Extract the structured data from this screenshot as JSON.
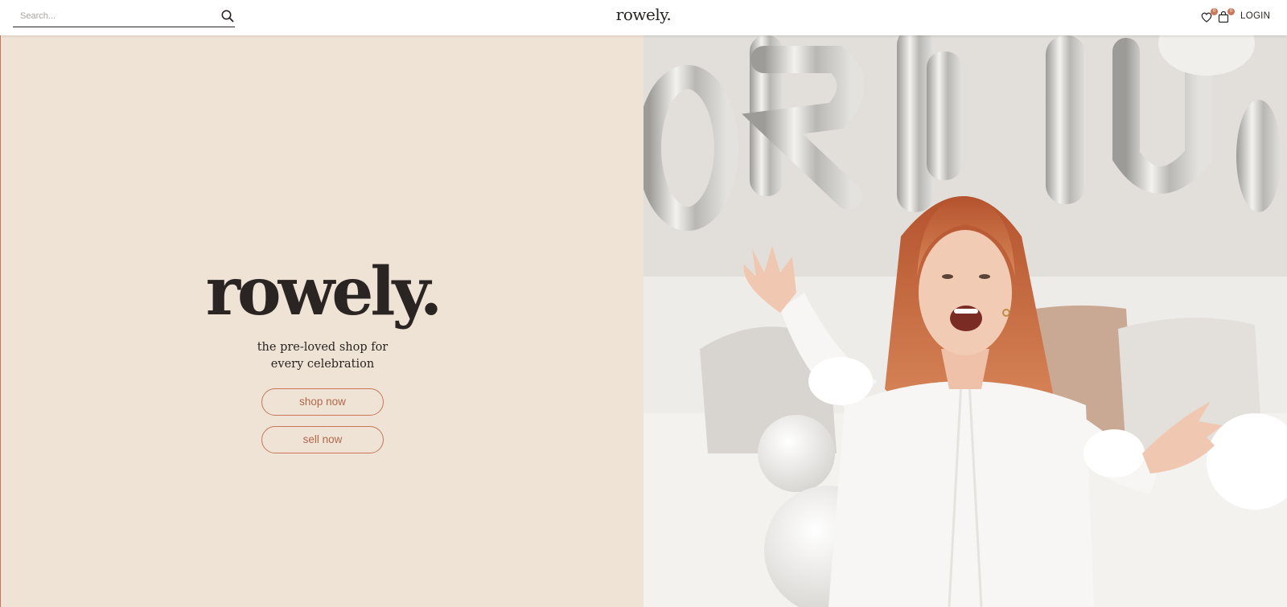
{
  "header": {
    "search": {
      "placeholder": "Search..."
    },
    "brand": "rowely.",
    "wishlist_count": "0",
    "cart_count": "0",
    "login_label": "LOGIN"
  },
  "hero": {
    "title": "rowely.",
    "tagline_line1": "the pre-loved shop for",
    "tagline_line2": "every celebration",
    "shop_label": "shop now",
    "sell_label": "sell now"
  },
  "icons": {
    "search": "search-icon",
    "wishlist": "heart-icon",
    "cart": "shopping-bag-icon"
  },
  "colors": {
    "accent": "#c9765a",
    "hero_bg": "#efe3d5",
    "text": "#2a2523"
  }
}
